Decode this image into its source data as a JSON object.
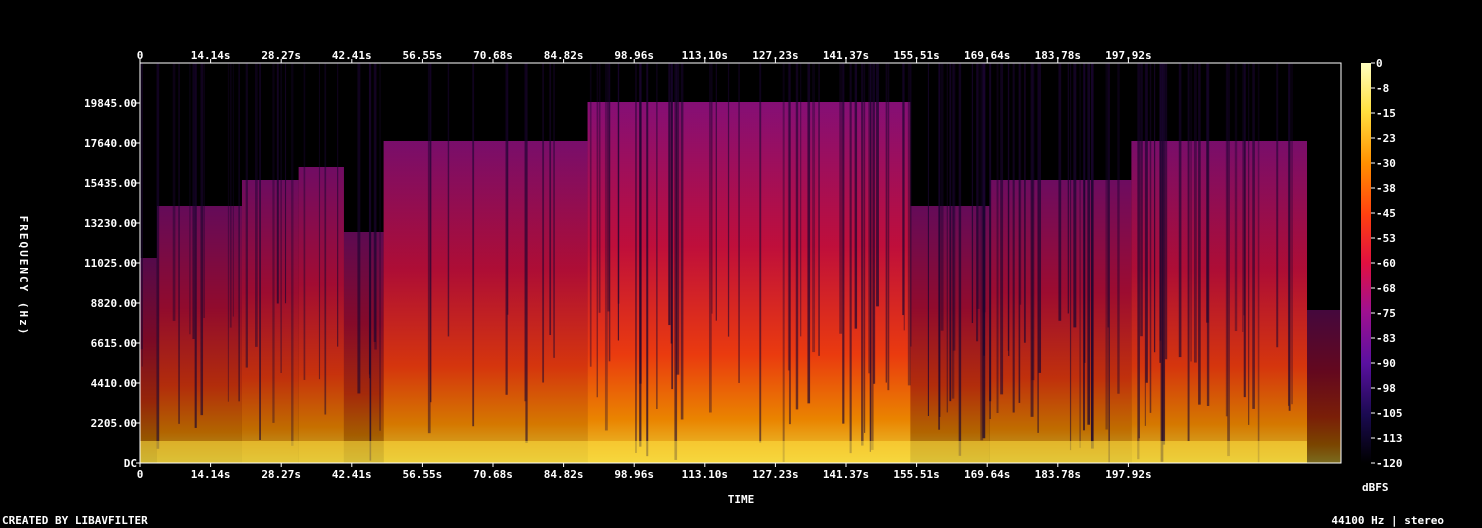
{
  "chart_data": {
    "type": "heatmap",
    "title": "",
    "xlabel": "TIME",
    "ylabel": "FREQUENCY (Hz)",
    "x_ticks": [
      "0",
      "14.14s",
      "28.27s",
      "42.41s",
      "56.55s",
      "70.68s",
      "84.82s",
      "98.96s",
      "113.10s",
      "127.23s",
      "141.37s",
      "155.51s",
      "169.64s",
      "183.78s",
      "197.92s"
    ],
    "x_range_s": [
      0,
      212
    ],
    "y_ticks": [
      "DC",
      "2205.00",
      "4410.00",
      "6615.00",
      "8820.00",
      "11025.00",
      "13230.00",
      "15435.00",
      "17640.00",
      "19845.00"
    ],
    "y_range_hz": [
      0,
      22050
    ],
    "colorbar_label": "dBFS",
    "colorbar_ticks": [
      "0",
      "-8",
      "-15",
      "-23",
      "-30",
      "-38",
      "-45",
      "-53",
      "-60",
      "-68",
      "-75",
      "-83",
      "-90",
      "-98",
      "-105",
      "-113",
      "-120"
    ],
    "colorbar_range_db": [
      -120,
      0
    ],
    "colormap": [
      "#000000",
      "#1a0a50",
      "#5a10a0",
      "#a01090",
      "#e01040",
      "#ff4010",
      "#ff9000",
      "#ffe040",
      "#ffffc0"
    ],
    "energy_profile_seconds": [
      {
        "t0": 0,
        "t1": 3,
        "level": 0.25
      },
      {
        "t0": 3,
        "t1": 18,
        "level": 0.45
      },
      {
        "t0": 18,
        "t1": 28,
        "level": 0.55
      },
      {
        "t0": 28,
        "t1": 36,
        "level": 0.6
      },
      {
        "t0": 36,
        "t1": 43,
        "level": 0.35
      },
      {
        "t0": 43,
        "t1": 79,
        "level": 0.7
      },
      {
        "t0": 79,
        "t1": 136,
        "level": 0.85
      },
      {
        "t0": 136,
        "t1": 150,
        "level": 0.45
      },
      {
        "t0": 150,
        "t1": 175,
        "level": 0.55
      },
      {
        "t0": 175,
        "t1": 206,
        "level": 0.7
      },
      {
        "t0": 206,
        "t1": 212,
        "level": 0.05
      }
    ]
  },
  "footer": {
    "left": "CREATED BY LIBAVFILTER",
    "right": "44100 Hz | stereo"
  }
}
